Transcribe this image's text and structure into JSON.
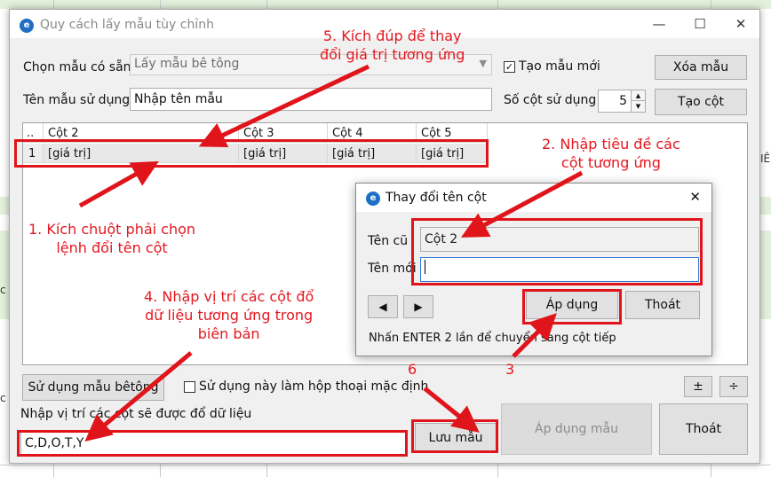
{
  "window": {
    "title": "Quy cách lấy mẫu tùy chỉnh",
    "min_glyph": "—",
    "max_glyph": "☐",
    "close_glyph": "✕"
  },
  "form": {
    "template_label": "Chọn mẫu có sẵn",
    "template_value": "Lấy mẫu bê tông",
    "new_template_checkbox_label": "Tạo mẫu mới",
    "new_template_checked": true,
    "delete_button": "Xóa mẫu",
    "name_label": "Tên mẫu sử dụng",
    "name_value": "Nhập tên mẫu",
    "columns_label": "Số cột sử dụng",
    "columns_value": "5",
    "create_columns_button": "Tạo cột"
  },
  "grid": {
    "row_header_glyph": "..",
    "columns": [
      "Cột 2",
      "Cột 3",
      "Cột 4",
      "Cột 5"
    ],
    "rows": [
      {
        "index": "1",
        "cells": [
          "[giá trị]",
          "[giá trị]",
          "[giá trị]",
          "[giá trị]"
        ]
      }
    ]
  },
  "bottom": {
    "use_concrete_button": "Sử dụng mẫu bêtông",
    "default_checkbox_label": "Sử dụng này làm hộp thoại mặc định",
    "plus_minus_button": "±",
    "divide_button": "÷",
    "positions_label": "Nhập vị trí các cột sẽ được đổ dữ liệu",
    "positions_value": "C,D,O,T,Y",
    "save_button": "Lưu mẫu",
    "apply_template_button": "Áp dụng mẫu",
    "exit_button": "Thoát"
  },
  "rename_dialog": {
    "title": "Thay đổi tên cột",
    "close_glyph": "✕",
    "old_name_label": "Tên cũ",
    "old_name_value": "Cột 2",
    "new_name_label": "Tên mới",
    "new_name_value": "",
    "prev_glyph": "◀",
    "next_glyph": "▶",
    "apply_button": "Áp dụng",
    "exit_button": "Thoát",
    "hint": "Nhấn ENTER 2 lần để chuyển sang cột tiếp"
  },
  "background_fragments": {
    "right_edge_1": "IÊ",
    "left_edge_1": "c",
    "left_edge_2": "c"
  },
  "annotations": {
    "step1": [
      "1. Kích chuột phải chọn",
      "lệnh đổi tên cột"
    ],
    "step2": [
      "2. Nhập tiêu đề các",
      "cột tương ứng"
    ],
    "step3": "3",
    "step4": [
      "4. Nhập vị trí các cột đổ",
      "dữ liệu tương ứng trong",
      "biên bản"
    ],
    "step5": [
      "5. Kích đúp để thay",
      "đổi giá trị tương ứng"
    ],
    "step6": "6",
    "color": "#e3181f"
  }
}
